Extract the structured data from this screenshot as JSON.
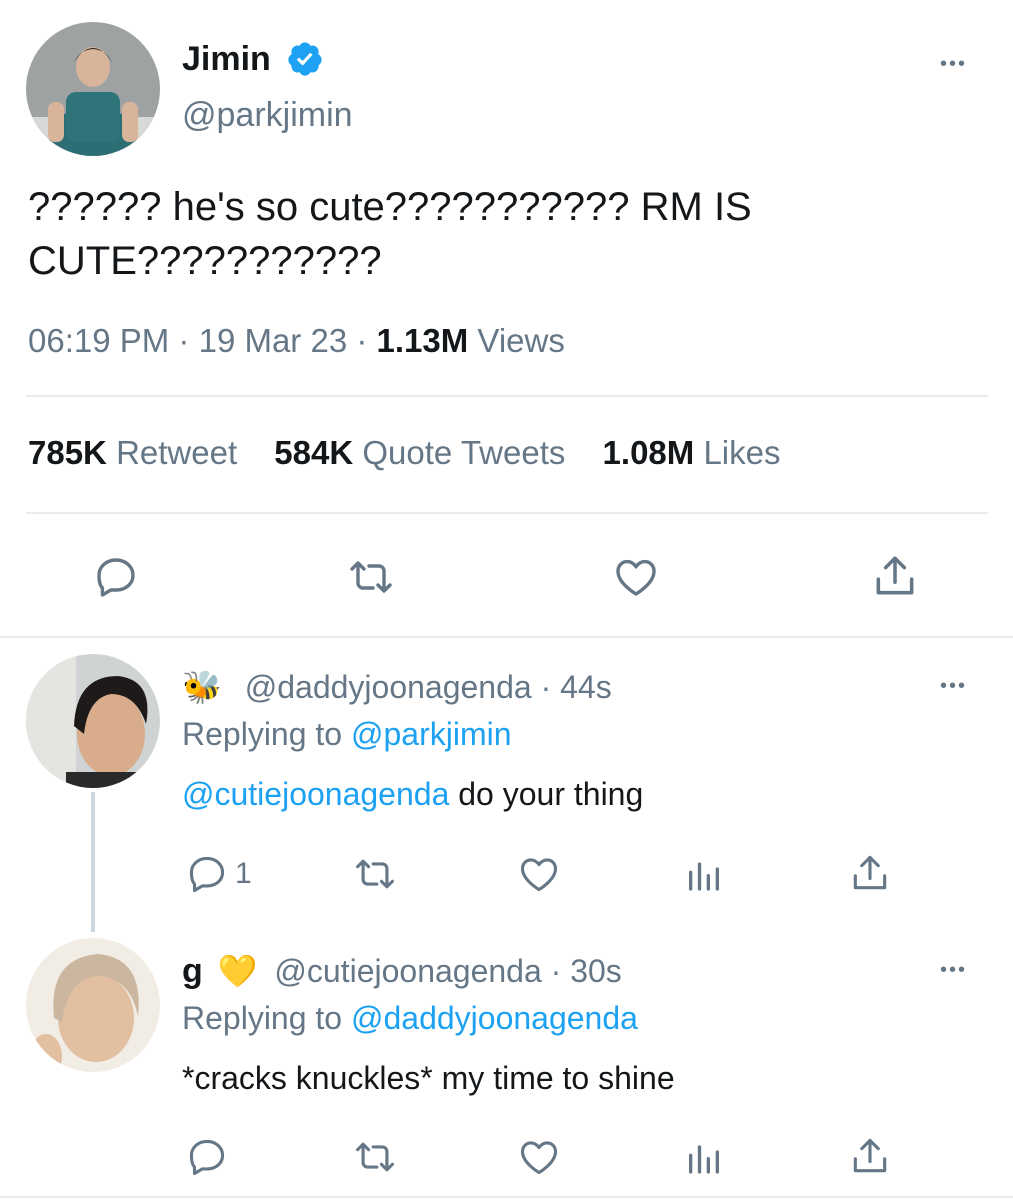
{
  "main_tweet": {
    "display_name": "Jimin",
    "handle": "@parkjimin",
    "text_line1": "?????? he's so cute??????????? RM IS",
    "text_line2": "CUTE???????????",
    "time": "06:19 PM",
    "date": "19 Mar 23",
    "views_count": "1.13M",
    "views_label": "Views",
    "retweets_count": "785K",
    "retweets_label": "Retweet",
    "quotes_count": "584K",
    "quotes_label": "Quote Tweets",
    "likes_count": "1.08M",
    "likes_label": "Likes",
    "more_label": "•••",
    "separator": "·"
  },
  "replies": [
    {
      "display_name": "🐝",
      "handle": "@daddyjoonagenda",
      "age": "44s",
      "replying_prefix": "Replying to",
      "replying_to": "@parkjimin",
      "mention": "@cutiejoonagenda",
      "text": " do your thing",
      "reply_count": "1",
      "more_label": "•••"
    },
    {
      "display_name": "g",
      "emoji": "💛",
      "handle": "@cutiejoonagenda",
      "age": "30s",
      "replying_prefix": "Replying to",
      "replying_to": "@daddyjoonagenda",
      "text": "*cracks knuckles* my time to shine",
      "more_label": "•••"
    }
  ],
  "colors": {
    "accent": "#1da1f2",
    "muted": "#657786",
    "text": "#14171a",
    "divider": "#e6ecf0"
  }
}
